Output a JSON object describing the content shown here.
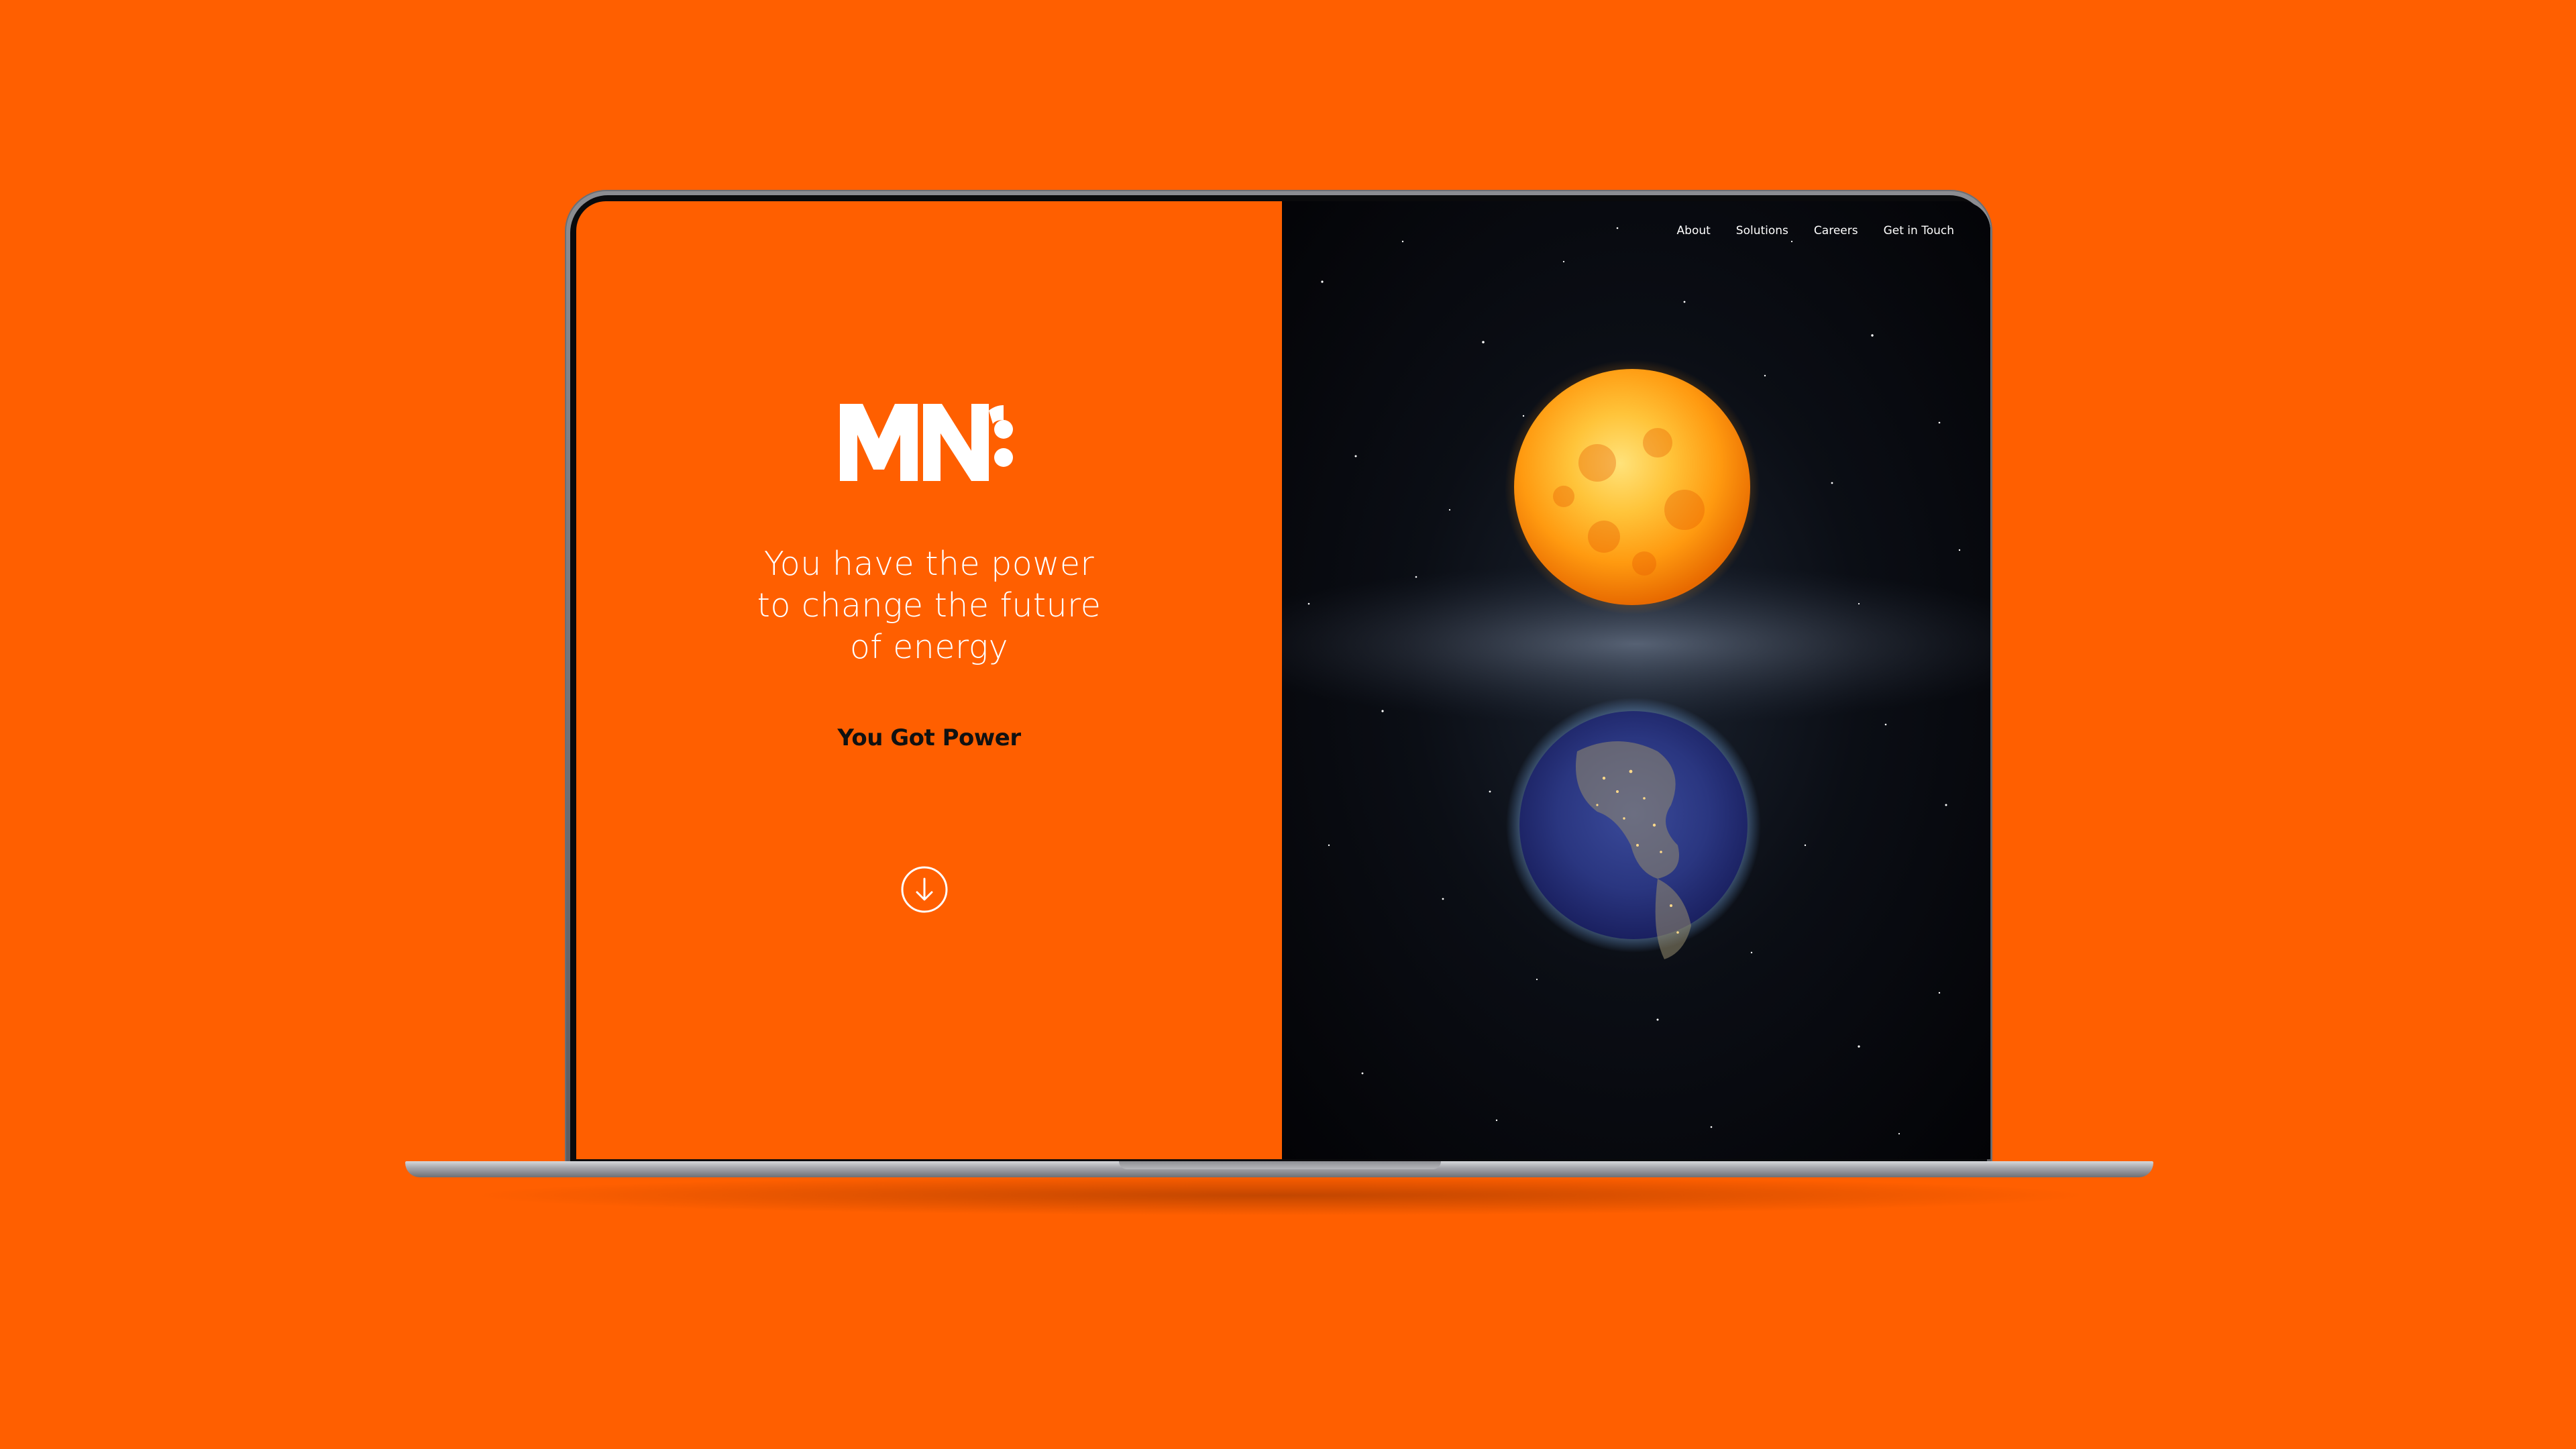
{
  "brand": {
    "logo_text": "MN8",
    "accent_color": "#ff5f00"
  },
  "nav": {
    "items": [
      {
        "label": "About"
      },
      {
        "label": "Solutions"
      },
      {
        "label": "Careers"
      },
      {
        "label": "Get in Touch"
      }
    ]
  },
  "hero": {
    "tagline_lines": [
      "You have the power",
      "to change the future",
      "of energy"
    ],
    "subtitle": "You Got Power",
    "scroll_icon": "arrow-down-circle-icon"
  },
  "imagery": {
    "top": "sun",
    "bottom": "earth",
    "background": "starfield-milky-way"
  }
}
